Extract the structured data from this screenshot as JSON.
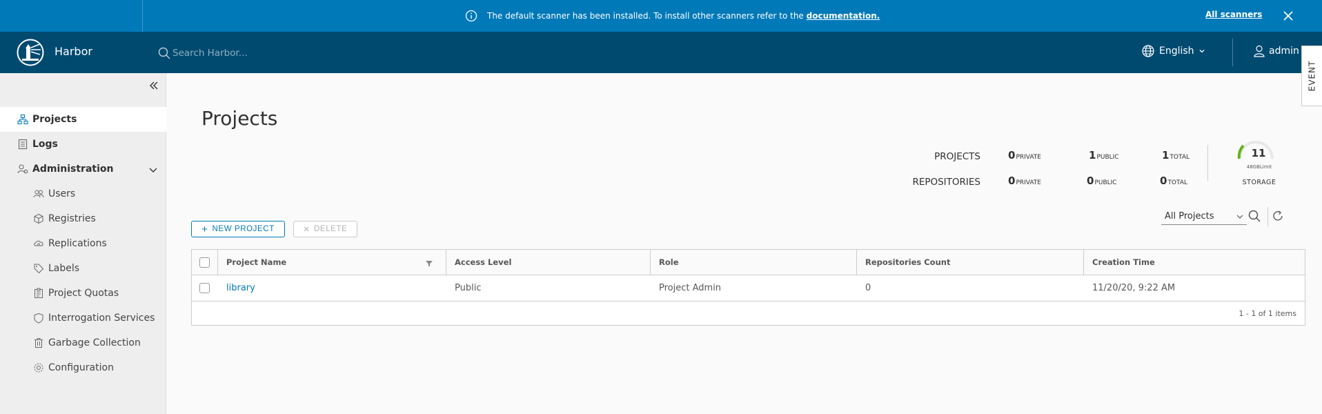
{
  "banner": {
    "message": "The default scanner has been installed. To install other scanners refer to the",
    "link_text": "documentation.",
    "all_scanners": "All scanners",
    "color": "#0079b8"
  },
  "header": {
    "brand": "Harbor",
    "search_placeholder": "Search Harbor...",
    "language": "English",
    "user": "admin",
    "color": "#004a70"
  },
  "event_tab": "EVENT",
  "sidebar": {
    "items": [
      {
        "label": "Projects",
        "icon": "projects-icon"
      },
      {
        "label": "Logs",
        "icon": "logs-icon"
      },
      {
        "label": "Administration",
        "icon": "administration-icon"
      }
    ],
    "admin_items": [
      {
        "label": "Users",
        "icon": "users-icon"
      },
      {
        "label": "Registries",
        "icon": "registries-icon"
      },
      {
        "label": "Replications",
        "icon": "replications-icon"
      },
      {
        "label": "Labels",
        "icon": "labels-icon"
      },
      {
        "label": "Project Quotas",
        "icon": "project-quotas-icon"
      },
      {
        "label": "Interrogation Services",
        "icon": "interrogation-services-icon"
      },
      {
        "label": "Garbage Collection",
        "icon": "garbage-collection-icon"
      },
      {
        "label": "Configuration",
        "icon": "configuration-icon"
      }
    ]
  },
  "main": {
    "title": "Projects",
    "stats": {
      "projects_label": "PROJECTS",
      "repositories_label": "REPOSITORIES",
      "projects": {
        "private": "0",
        "public": "1",
        "total": "1"
      },
      "repositories": {
        "private": "0",
        "public": "0",
        "total": "0"
      },
      "private_suffix": "PRIVATE",
      "public_suffix": "PUBLIC",
      "total_suffix": "TOTAL",
      "storage_value": "11",
      "storage_limit": "48GBLimit",
      "storage_label": "STORAGE"
    },
    "new_project": "NEW PROJECT",
    "delete": "DELETE",
    "filter_selected": "All Projects",
    "columns": [
      "Project Name",
      "Access Level",
      "Role",
      "Repositories Count",
      "Creation Time"
    ],
    "rows": [
      {
        "name": "library",
        "access": "Public",
        "role": "Project Admin",
        "repo_count": "0",
        "created": "11/20/20, 9:22 AM"
      }
    ],
    "pagination": "1 - 1 of 1 items"
  }
}
